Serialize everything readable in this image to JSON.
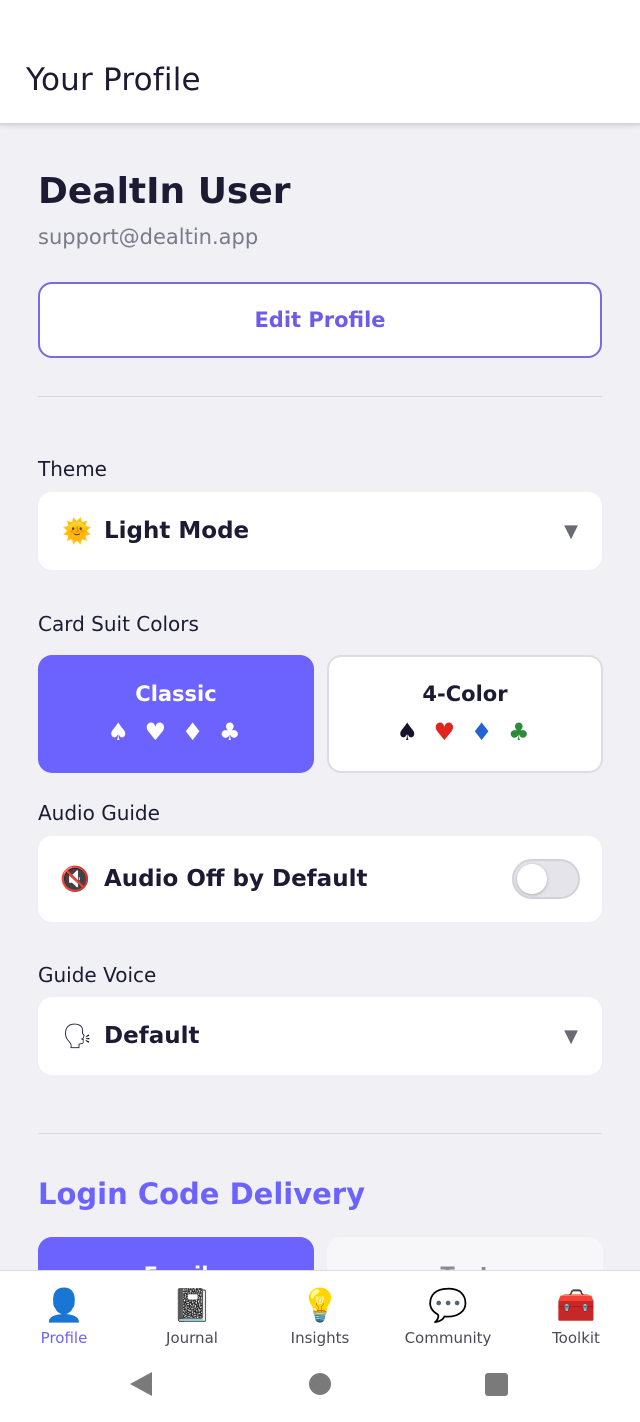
{
  "header": {
    "title": "Your Profile"
  },
  "profile": {
    "name": "DealtIn User",
    "email": "support@dealtin.app",
    "edit_label": "Edit Profile"
  },
  "theme": {
    "label": "Theme",
    "icon": "sun-icon",
    "emoji": "🌞",
    "value": "Light Mode",
    "chevron": "▼"
  },
  "card_suits": {
    "label": "Card Suit Colors",
    "options": [
      {
        "title": "Classic",
        "suits": [
          "♠",
          "♥",
          "♦",
          "♣"
        ],
        "selected": true
      },
      {
        "title": "4-Color",
        "suits": [
          "♠",
          "♥",
          "♦",
          "♣"
        ],
        "selected": false
      }
    ],
    "four_color_palette": [
      "#14132b",
      "#e0251f",
      "#1f63d6",
      "#2e8b3a"
    ]
  },
  "audio": {
    "label": "Audio Guide",
    "icon": "muted-speaker-icon",
    "emoji": "🔇",
    "value": "Audio Off by Default",
    "enabled": false
  },
  "voice": {
    "label": "Guide Voice",
    "icon": "speaking-head-icon",
    "emoji": "🗣",
    "value": "Default",
    "chevron": "▼"
  },
  "login_delivery": {
    "title": "Login Code Delivery",
    "options": [
      {
        "label": "Email",
        "selected": true
      },
      {
        "label": "Text",
        "selected": false
      }
    ]
  },
  "tabbar": {
    "items": [
      {
        "label": "Profile",
        "icon": "profile-icon",
        "emoji": "👤",
        "active": true
      },
      {
        "label": "Journal",
        "icon": "journal-icon",
        "emoji": "📓",
        "active": false
      },
      {
        "label": "Insights",
        "icon": "lightbulb-icon",
        "emoji": "💡",
        "active": false
      },
      {
        "label": "Community",
        "icon": "speech-bubble-icon",
        "emoji": "💬",
        "active": false
      },
      {
        "label": "Toolkit",
        "icon": "toolbox-icon",
        "emoji": "🧰",
        "active": false
      }
    ]
  },
  "colors": {
    "accent": "#6c63ff",
    "text": "#1c1b33",
    "muted": "#7a7a88",
    "background": "#f0f0f5"
  }
}
